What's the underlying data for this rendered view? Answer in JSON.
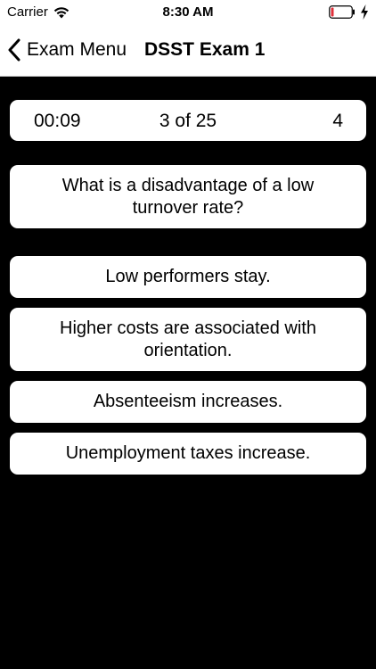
{
  "status_bar": {
    "carrier": "Carrier",
    "time": "8:30 AM",
    "battery_color": "#e0303a"
  },
  "nav": {
    "back_label": "Exam Menu",
    "title": "DSST Exam 1"
  },
  "quiz": {
    "timer": "00:09",
    "progress": "3 of 25",
    "score": "4",
    "question": "What is a disadvantage of a low turnover rate?",
    "answers": [
      "Low performers stay.",
      "Higher costs are associated with orientation.",
      "Absenteeism increases.",
      "Unemployment taxes increase."
    ]
  },
  "colors": {
    "background": "#000000",
    "card": "#ffffff",
    "text": "#000000"
  }
}
